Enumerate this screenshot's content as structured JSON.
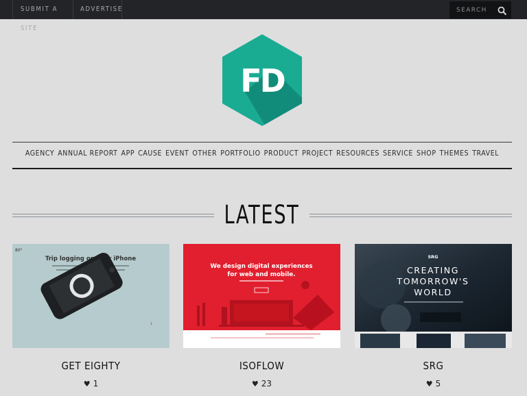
{
  "topbar": {
    "links": [
      "Submit a site",
      "Advertise"
    ],
    "search_placeholder": "SEARCH"
  },
  "logo": {
    "text": "FD",
    "color": "#1aab93"
  },
  "nav": [
    "AGENCY",
    "ANNUAL REPORT",
    "APP",
    "CAUSE",
    "EVENT",
    "OTHER",
    "PORTFOLIO",
    "PRODUCT",
    "PROJECT",
    "RESOURCES",
    "SERVICE",
    "SHOP",
    "THEMES",
    "TRAVEL"
  ],
  "section_title": "LATEST",
  "cards": [
    {
      "title": "GET EIGHTY",
      "likes": "1",
      "thumb": {
        "headline": "Trip logging on your iPhone",
        "corner": "80°",
        "bg": "#b7ccce"
      }
    },
    {
      "title": "ISOFLOW",
      "likes": "23",
      "thumb": {
        "headline1": "We design digital experiences",
        "headline2": "for web and mobile.",
        "bg": "#e32030"
      }
    },
    {
      "title": "SRG",
      "likes": "5",
      "thumb": {
        "brand": "SRG",
        "line1": "CREATING",
        "line2": "TOMORROW'S",
        "line3": "WORLD",
        "bg": "#1c2530"
      }
    }
  ]
}
